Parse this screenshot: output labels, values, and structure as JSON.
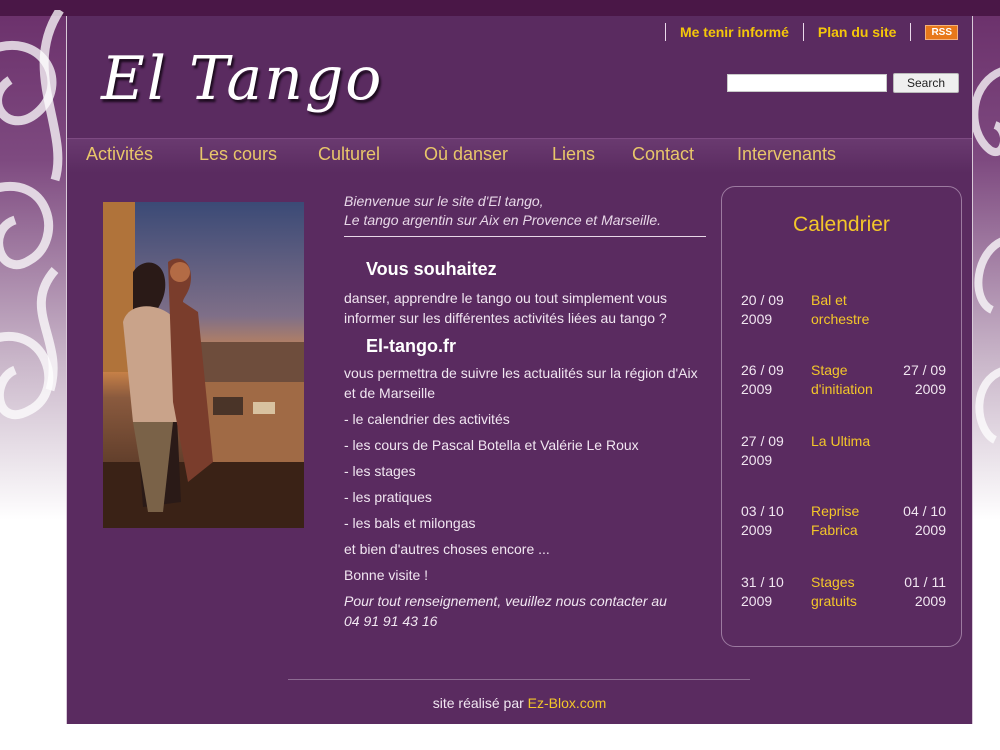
{
  "site": {
    "logo": "El Tango"
  },
  "header": {
    "links": [
      {
        "label": "Me tenir informé"
      },
      {
        "label": "Plan du site"
      }
    ],
    "rss_label": "RSS",
    "search": {
      "placeholder": "",
      "button_label": "Search"
    }
  },
  "nav": {
    "items": [
      {
        "label": "Activités"
      },
      {
        "label": "Les cours"
      },
      {
        "label": "Culturel"
      },
      {
        "label": "Où danser"
      },
      {
        "label": "Liens"
      },
      {
        "label": "Contact"
      },
      {
        "label": "Intervenants"
      }
    ]
  },
  "main": {
    "welcome_line1": "Bienvenue sur le site d'El tango,",
    "welcome_line2": "Le tango argentin sur Aix en Provence et Marseille.",
    "heading1": "Vous souhaitez",
    "para1": "danser, apprendre le tango ou tout simplement vous informer sur les différentes activités liées au tango ?",
    "heading2": "El-tango.fr",
    "para2": "vous permettra de suivre les actualités sur la région d'Aix et de Marseille",
    "list": [
      "- le calendrier des activités",
      "- les cours de Pascal Botella et Valérie Le Roux",
      "- les stages",
      "- les pratiques",
      "- les bals et milongas"
    ],
    "more": "et bien d'autres choses encore ...",
    "bonne": "Bonne visite !",
    "contact_line1": "Pour tout renseignement, veuillez nous contacter au",
    "contact_line2": "04 91 91 43 16"
  },
  "calendar": {
    "title": "Calendrier",
    "events": [
      {
        "start_l1": "20 / 09",
        "start_l2": "2009",
        "label_l1": "Bal et",
        "label_l2": "orchestre",
        "end_l1": "",
        "end_l2": ""
      },
      {
        "start_l1": "26 / 09",
        "start_l2": "2009",
        "label_l1": "Stage",
        "label_l2": "d'initiation",
        "end_l1": "27 / 09",
        "end_l2": "2009"
      },
      {
        "start_l1": "27 / 09",
        "start_l2": "2009",
        "label_l1": "La Ultima",
        "label_l2": "",
        "end_l1": "",
        "end_l2": ""
      },
      {
        "start_l1": "03 / 10",
        "start_l2": "2009",
        "label_l1": "Reprise",
        "label_l2": "Fabrica",
        "end_l1": "04 / 10",
        "end_l2": "2009"
      },
      {
        "start_l1": "31 / 10",
        "start_l2": "2009",
        "label_l1": "Stages",
        "label_l2": "gratuits",
        "end_l1": "01 / 11",
        "end_l2": "2009"
      }
    ]
  },
  "footer": {
    "text": "site réalisé par",
    "link": "Ez-Blox.com"
  },
  "colors": {
    "page_bg": "#5a2b60",
    "accent": "#f3c62a",
    "rss": "#e8781a"
  }
}
